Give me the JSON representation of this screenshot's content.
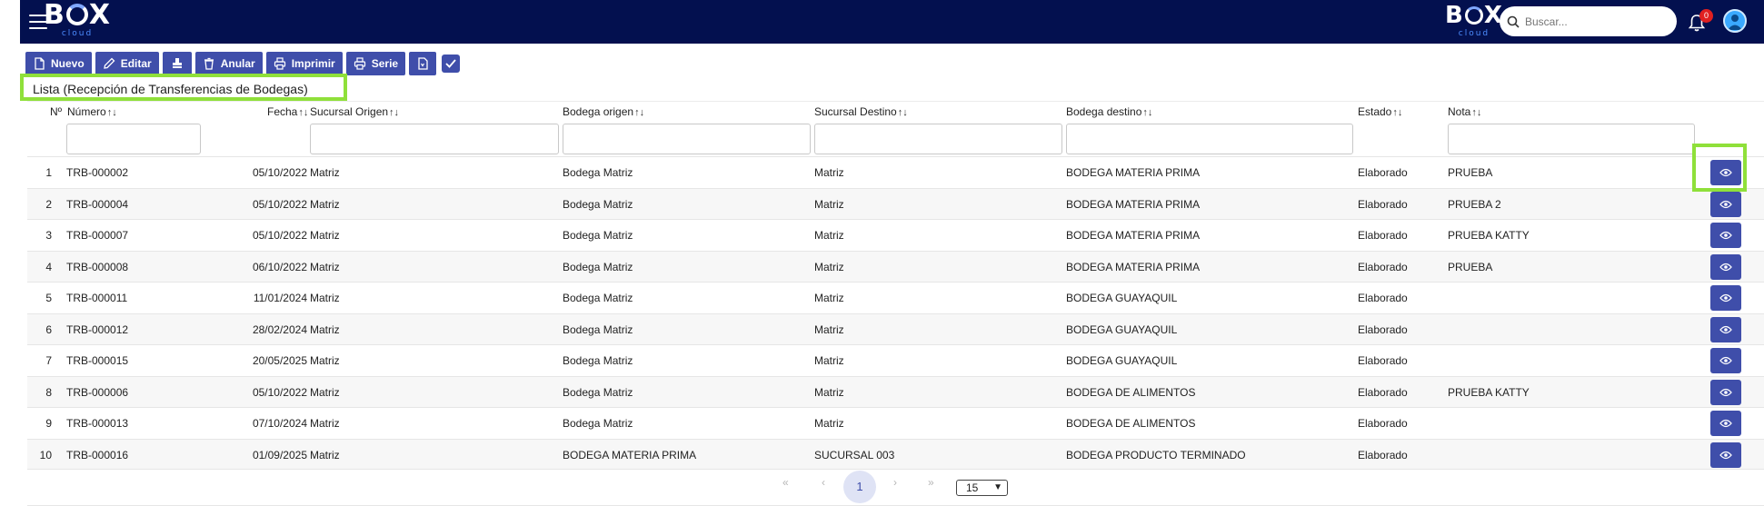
{
  "header": {
    "logo_text_left": "B",
    "logo_text_right": "X",
    "logo_sub": "cloud",
    "search_placeholder": "Buscar...",
    "notification_count": "0"
  },
  "toolbar": {
    "nuevo": "Nuevo",
    "editar": "Editar",
    "anular": "Anular",
    "imprimir": "Imprimir",
    "serie": "Serie"
  },
  "title": "Lista (Recepción de Transferencias de Bodegas)",
  "columns": {
    "no": "Nº",
    "numero": "Número",
    "fecha": "Fecha",
    "sucursal_origen": "Sucursal Origen",
    "bodega_origen": "Bodega origen",
    "sucursal_destino": "Sucursal Destino",
    "bodega_destino": "Bodega destino",
    "estado": "Estado",
    "nota": "Nota"
  },
  "rows": [
    {
      "no": "1",
      "numero": "TRB-000002",
      "fecha": "05/10/2022",
      "sucursal_origen": "Matriz",
      "bodega_origen": "Bodega Matriz",
      "sucursal_destino": "Matriz",
      "bodega_destino": "BODEGA MATERIA PRIMA",
      "estado": "Elaborado",
      "nota": "PRUEBA"
    },
    {
      "no": "2",
      "numero": "TRB-000004",
      "fecha": "05/10/2022",
      "sucursal_origen": "Matriz",
      "bodega_origen": "Bodega Matriz",
      "sucursal_destino": "Matriz",
      "bodega_destino": "BODEGA MATERIA PRIMA",
      "estado": "Elaborado",
      "nota": "PRUEBA 2"
    },
    {
      "no": "3",
      "numero": "TRB-000007",
      "fecha": "05/10/2022",
      "sucursal_origen": "Matriz",
      "bodega_origen": "Bodega Matriz",
      "sucursal_destino": "Matriz",
      "bodega_destino": "BODEGA MATERIA PRIMA",
      "estado": "Elaborado",
      "nota": "PRUEBA KATTY"
    },
    {
      "no": "4",
      "numero": "TRB-000008",
      "fecha": "06/10/2022",
      "sucursal_origen": "Matriz",
      "bodega_origen": "Bodega Matriz",
      "sucursal_destino": "Matriz",
      "bodega_destino": "BODEGA MATERIA PRIMA",
      "estado": "Elaborado",
      "nota": "PRUEBA"
    },
    {
      "no": "5",
      "numero": "TRB-000011",
      "fecha": "11/01/2024",
      "sucursal_origen": "Matriz",
      "bodega_origen": "Bodega Matriz",
      "sucursal_destino": "Matriz",
      "bodega_destino": "BODEGA GUAYAQUIL",
      "estado": "Elaborado",
      "nota": ""
    },
    {
      "no": "6",
      "numero": "TRB-000012",
      "fecha": "28/02/2024",
      "sucursal_origen": "Matriz",
      "bodega_origen": "Bodega Matriz",
      "sucursal_destino": "Matriz",
      "bodega_destino": "BODEGA GUAYAQUIL",
      "estado": "Elaborado",
      "nota": ""
    },
    {
      "no": "7",
      "numero": "TRB-000015",
      "fecha": "20/05/2025",
      "sucursal_origen": "Matriz",
      "bodega_origen": "Bodega Matriz",
      "sucursal_destino": "Matriz",
      "bodega_destino": "BODEGA GUAYAQUIL",
      "estado": "Elaborado",
      "nota": ""
    },
    {
      "no": "8",
      "numero": "TRB-000006",
      "fecha": "05/10/2022",
      "sucursal_origen": "Matriz",
      "bodega_origen": "Bodega Matriz",
      "sucursal_destino": "Matriz",
      "bodega_destino": "BODEGA DE ALIMENTOS",
      "estado": "Elaborado",
      "nota": "PRUEBA KATTY"
    },
    {
      "no": "9",
      "numero": "TRB-000013",
      "fecha": "07/10/2024",
      "sucursal_origen": "Matriz",
      "bodega_origen": "Bodega Matriz",
      "sucursal_destino": "Matriz",
      "bodega_destino": "BODEGA DE ALIMENTOS",
      "estado": "Elaborado",
      "nota": ""
    },
    {
      "no": "10",
      "numero": "TRB-000016",
      "fecha": "01/09/2025",
      "sucursal_origen": "Matriz",
      "bodega_origen": "BODEGA MATERIA PRIMA",
      "sucursal_destino": "SUCURSAL 003",
      "bodega_destino": "BODEGA PRODUCTO TERMINADO",
      "estado": "Elaborado",
      "nota": ""
    }
  ],
  "pagination": {
    "first": "«",
    "prev": "‹",
    "current": "1",
    "next": "›",
    "last": "»",
    "per_page": "15"
  },
  "colors": {
    "header_bg": "#03104f",
    "button": "#3f4eaa",
    "highlight": "#8fe03a"
  }
}
